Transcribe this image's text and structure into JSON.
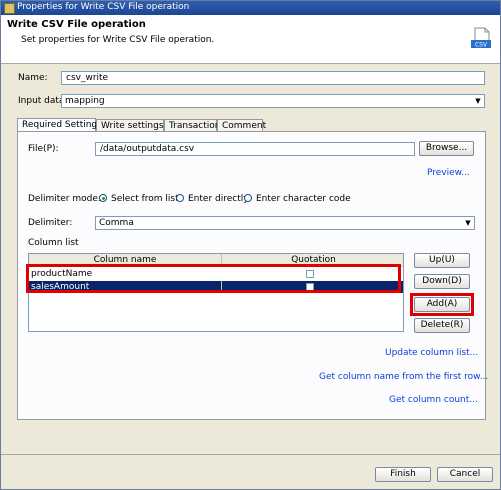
{
  "window": {
    "title": "Properties for Write CSV File operation"
  },
  "header": {
    "title": "Write CSV File operation",
    "subtitle": "Set properties for Write CSV File operation.",
    "icon_label": "CSV"
  },
  "name": {
    "label": "Name:",
    "value": "csv_write"
  },
  "input_data": {
    "label": "Input data:",
    "value": "mapping"
  },
  "tabs": [
    {
      "label": "Required Settings"
    },
    {
      "label": "Write settings"
    },
    {
      "label": "Transaction"
    },
    {
      "label": "Comment"
    }
  ],
  "file": {
    "label": "File(P):",
    "value": "/data/outputdata.csv",
    "browse_label": "Browse...",
    "preview_label": "Preview..."
  },
  "delimiter_mode": {
    "label": "Delimiter mode:",
    "options": [
      "Select from list",
      "Enter directly",
      "Enter character code"
    ],
    "selected": "Select from list"
  },
  "delimiter": {
    "label": "Delimiter:",
    "value": "Comma"
  },
  "column_list": {
    "label": "Column list",
    "headers": [
      "Column name",
      "Quotation"
    ],
    "rows": [
      {
        "name": "productName",
        "quotation": false
      },
      {
        "name": "salesAmount",
        "quotation": false
      }
    ],
    "selected_row": "salesAmount"
  },
  "side_buttons": {
    "up": "Up(U)",
    "down": "Down(D)",
    "add": "Add(A)",
    "delete": "Delete(R)"
  },
  "links": {
    "update": "Update column list...",
    "get_first_row": "Get column name from the first row...",
    "get_count": "Get column count..."
  },
  "footer": {
    "finish": "Finish",
    "cancel": "Cancel"
  },
  "colors": {
    "highlight": "#e00000",
    "selection": "#0a246a",
    "link": "#0a3fd6"
  }
}
